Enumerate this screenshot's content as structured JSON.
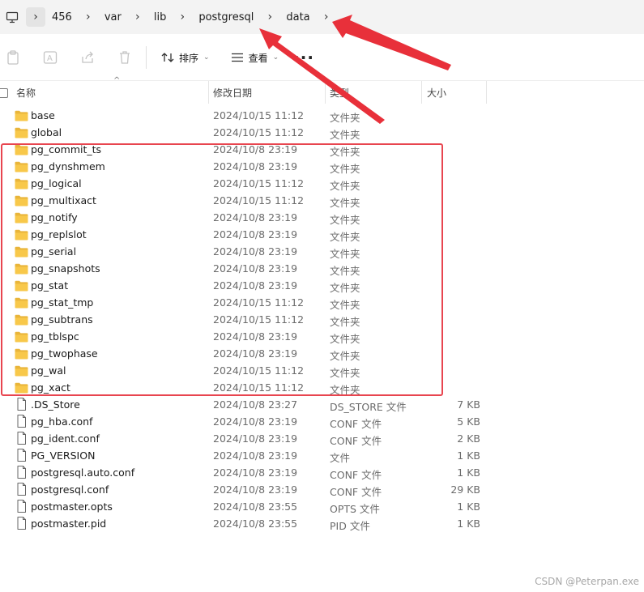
{
  "breadcrumb": [
    "456",
    "var",
    "lib",
    "postgresql",
    "data"
  ],
  "toolbar": {
    "sort_label": "排序",
    "view_label": "查看",
    "more_label": "···"
  },
  "columns": {
    "name": "名称",
    "modified": "修改日期",
    "type": "类型",
    "size": "大小"
  },
  "files": [
    {
      "name": "base",
      "modified": "2024/10/15 11:12",
      "type": "文件夹",
      "size": "",
      "kind": "folder"
    },
    {
      "name": "global",
      "modified": "2024/10/15 11:12",
      "type": "文件夹",
      "size": "",
      "kind": "folder"
    },
    {
      "name": "pg_commit_ts",
      "modified": "2024/10/8 23:19",
      "type": "文件夹",
      "size": "",
      "kind": "folder"
    },
    {
      "name": "pg_dynshmem",
      "modified": "2024/10/8 23:19",
      "type": "文件夹",
      "size": "",
      "kind": "folder"
    },
    {
      "name": "pg_logical",
      "modified": "2024/10/15 11:12",
      "type": "文件夹",
      "size": "",
      "kind": "folder"
    },
    {
      "name": "pg_multixact",
      "modified": "2024/10/15 11:12",
      "type": "文件夹",
      "size": "",
      "kind": "folder"
    },
    {
      "name": "pg_notify",
      "modified": "2024/10/8 23:19",
      "type": "文件夹",
      "size": "",
      "kind": "folder"
    },
    {
      "name": "pg_replslot",
      "modified": "2024/10/8 23:19",
      "type": "文件夹",
      "size": "",
      "kind": "folder"
    },
    {
      "name": "pg_serial",
      "modified": "2024/10/8 23:19",
      "type": "文件夹",
      "size": "",
      "kind": "folder"
    },
    {
      "name": "pg_snapshots",
      "modified": "2024/10/8 23:19",
      "type": "文件夹",
      "size": "",
      "kind": "folder"
    },
    {
      "name": "pg_stat",
      "modified": "2024/10/8 23:19",
      "type": "文件夹",
      "size": "",
      "kind": "folder"
    },
    {
      "name": "pg_stat_tmp",
      "modified": "2024/10/15 11:12",
      "type": "文件夹",
      "size": "",
      "kind": "folder"
    },
    {
      "name": "pg_subtrans",
      "modified": "2024/10/15 11:12",
      "type": "文件夹",
      "size": "",
      "kind": "folder"
    },
    {
      "name": "pg_tblspc",
      "modified": "2024/10/8 23:19",
      "type": "文件夹",
      "size": "",
      "kind": "folder"
    },
    {
      "name": "pg_twophase",
      "modified": "2024/10/8 23:19",
      "type": "文件夹",
      "size": "",
      "kind": "folder"
    },
    {
      "name": "pg_wal",
      "modified": "2024/10/15 11:12",
      "type": "文件夹",
      "size": "",
      "kind": "folder"
    },
    {
      "name": "pg_xact",
      "modified": "2024/10/15 11:12",
      "type": "文件夹",
      "size": "",
      "kind": "folder"
    },
    {
      "name": ".DS_Store",
      "modified": "2024/10/8 23:27",
      "type": "DS_STORE 文件",
      "size": "7 KB",
      "kind": "file"
    },
    {
      "name": "pg_hba.conf",
      "modified": "2024/10/8 23:19",
      "type": "CONF 文件",
      "size": "5 KB",
      "kind": "file"
    },
    {
      "name": "pg_ident.conf",
      "modified": "2024/10/8 23:19",
      "type": "CONF 文件",
      "size": "2 KB",
      "kind": "file"
    },
    {
      "name": "PG_VERSION",
      "modified": "2024/10/8 23:19",
      "type": "文件",
      "size": "1 KB",
      "kind": "file"
    },
    {
      "name": "postgresql.auto.conf",
      "modified": "2024/10/8 23:19",
      "type": "CONF 文件",
      "size": "1 KB",
      "kind": "file"
    },
    {
      "name": "postgresql.conf",
      "modified": "2024/10/8 23:19",
      "type": "CONF 文件",
      "size": "29 KB",
      "kind": "file"
    },
    {
      "name": "postmaster.opts",
      "modified": "2024/10/8 23:55",
      "type": "OPTS 文件",
      "size": "1 KB",
      "kind": "file"
    },
    {
      "name": "postmaster.pid",
      "modified": "2024/10/8 23:55",
      "type": "PID 文件",
      "size": "1 KB",
      "kind": "file"
    }
  ],
  "watermark": "CSDN @Peterpan.exe",
  "colors": {
    "highlight": "#e8454f",
    "folder": "#f5c242"
  }
}
